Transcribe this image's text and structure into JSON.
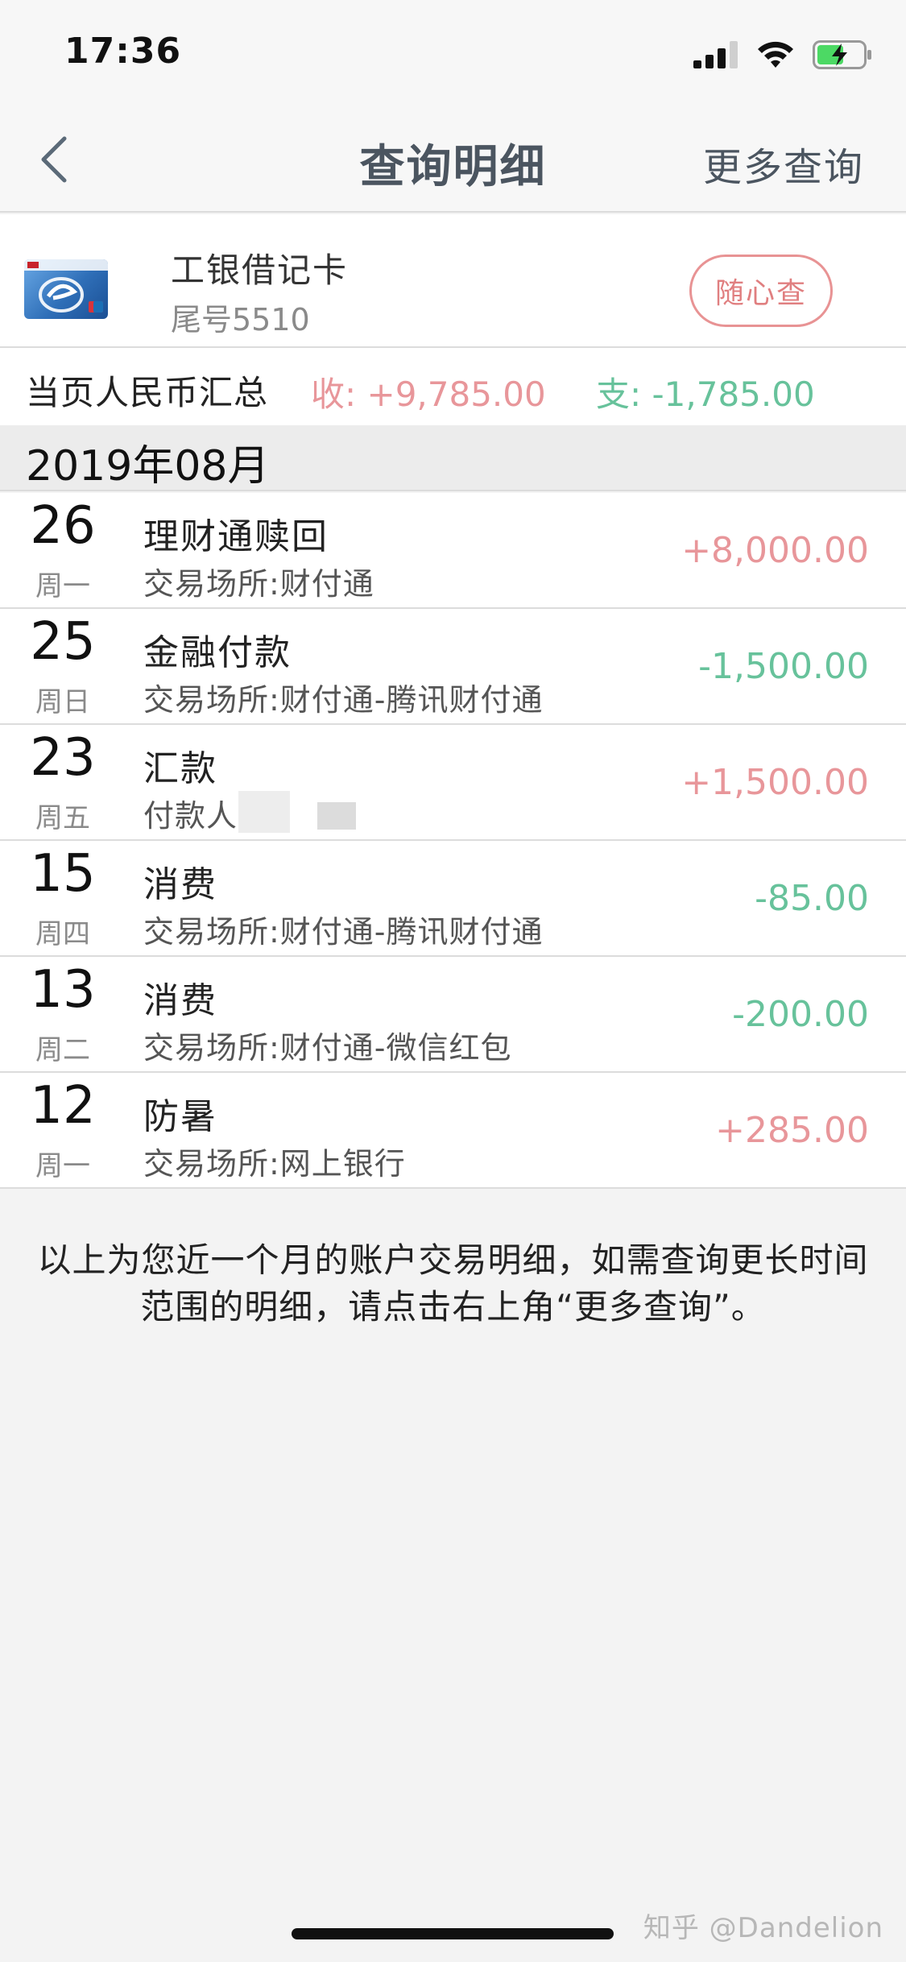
{
  "status_bar": {
    "time": "17:36"
  },
  "nav": {
    "title": "查询明细",
    "more_label": "更多查询"
  },
  "card": {
    "name": "工银借记卡",
    "tail": "尾号5510",
    "random_query_label": "随心查"
  },
  "summary": {
    "label": "当页人民币汇总",
    "income": "收: +9,785.00",
    "expense": "支: -1,785.00"
  },
  "month": "2019年08月",
  "transactions": [
    {
      "day": "26",
      "weekday": "周一",
      "title": "理财通赎回",
      "sub": "交易场所:财付通",
      "amount": "+8,000.00",
      "type": "income"
    },
    {
      "day": "25",
      "weekday": "周日",
      "title": "金融付款",
      "sub": "交易场所:财付通-腾讯财付通",
      "amount": "-1,500.00",
      "type": "expense"
    },
    {
      "day": "23",
      "weekday": "周五",
      "title": "汇款",
      "sub": "付款人",
      "amount": "+1,500.00",
      "type": "income"
    },
    {
      "day": "15",
      "weekday": "周四",
      "title": "消费",
      "sub": "交易场所:财付通-腾讯财付通",
      "amount": "-85.00",
      "type": "expense"
    },
    {
      "day": "13",
      "weekday": "周二",
      "title": "消费",
      "sub": "交易场所:财付通-微信红包",
      "amount": "-200.00",
      "type": "expense"
    },
    {
      "day": "12",
      "weekday": "周一",
      "title": "防暑",
      "sub": "交易场所:网上银行",
      "amount": "+285.00",
      "type": "income"
    }
  ],
  "footer_note": "以上为您近一个月的账户交易明细，如需查询更长时间范围的明细，请点击右上角“更多查询”。",
  "watermark": "知乎 @Dandelion",
  "colors": {
    "income": "#e8969a",
    "expense": "#67c29b",
    "accent_button": "#e07f80"
  }
}
